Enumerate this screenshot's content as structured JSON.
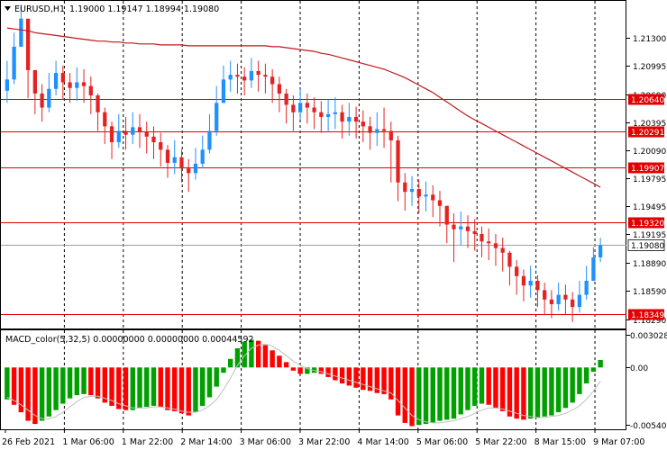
{
  "header": {
    "symbol": "EURUSD,H1",
    "ohlc": "1.19000 1.19147 1.18994 1.19080"
  },
  "chart_data": [
    {
      "type": "candlestick",
      "series": [
        {
          "name": "EURUSD,H1",
          "close": [
            1.2085,
            1.212,
            1.215,
            1.2095,
            1.207,
            1.2055,
            1.2075,
            1.2092,
            1.2082,
            1.2076,
            1.2082,
            1.2078,
            1.2068,
            1.205,
            1.2035,
            1.2018,
            1.203,
            1.2026,
            1.2034,
            1.2029,
            1.2024,
            1.2018,
            1.201,
            1.1996,
            1.2002,
            1.199,
            1.1985,
            1.1995,
            1.201,
            1.203,
            1.206,
            1.2085,
            1.209,
            1.2088,
            1.2084,
            1.2094,
            1.209,
            1.2088,
            1.208,
            1.207,
            1.2058,
            1.205,
            1.206,
            1.2055,
            1.205,
            1.2045,
            1.2048,
            1.205,
            1.204,
            1.2045,
            1.204,
            1.2035,
            1.2028,
            1.2032,
            1.203,
            1.202,
            1.1975,
            1.1965,
            1.1968,
            1.196,
            1.1962,
            1.1956,
            1.195,
            1.193,
            1.1925,
            1.1928,
            1.1923,
            1.192,
            1.1912,
            1.191,
            1.1905,
            1.19,
            1.1885,
            1.1875,
            1.1865,
            1.187,
            1.186,
            1.185,
            1.1845,
            1.1855,
            1.185,
            1.1842,
            1.1855,
            1.187,
            1.1895,
            1.1908
          ],
          "high": [
            1.2105,
            1.2135,
            1.2165,
            1.2125,
            1.209,
            1.208,
            1.2092,
            1.2105,
            1.21,
            1.2092,
            1.2098,
            1.2096,
            1.2088,
            1.207,
            1.2055,
            1.204,
            1.2048,
            1.2045,
            1.205,
            1.2048,
            1.204,
            1.2035,
            1.2028,
            1.2015,
            1.202,
            1.201,
            1.2,
            1.2012,
            1.2025,
            1.2048,
            1.2078,
            1.21,
            1.2105,
            1.2102,
            1.2098,
            1.2108,
            1.2105,
            1.2102,
            1.2096,
            1.2088,
            1.2075,
            1.2068,
            1.2075,
            1.207,
            1.2066,
            1.2062,
            1.2064,
            1.2066,
            1.2058,
            1.206,
            1.2056,
            1.2052,
            1.2045,
            1.205,
            1.2055,
            1.204,
            1.2025,
            1.1985,
            1.1982,
            1.1978,
            1.1976,
            1.1972,
            1.1966,
            1.195,
            1.1942,
            1.1944,
            1.194,
            1.1936,
            1.1928,
            1.1926,
            1.192,
            1.1916,
            1.1902,
            1.1892,
            1.1882,
            1.1886,
            1.1876,
            1.1868,
            1.186,
            1.1868,
            1.1866,
            1.1858,
            1.187,
            1.1886,
            1.1906,
            1.1916
          ],
          "low": [
            1.206,
            1.208,
            1.212,
            1.2065,
            1.2048,
            1.204,
            1.205,
            1.2068,
            1.2064,
            1.206,
            1.2062,
            1.206,
            1.2048,
            1.203,
            1.2016,
            1.2,
            1.2012,
            1.201,
            1.2016,
            1.2012,
            1.2006,
            1.2,
            1.1992,
            1.198,
            1.1984,
            1.1975,
            1.1965,
            1.1978,
            1.199,
            1.2006,
            1.2025,
            1.206,
            1.2072,
            1.207,
            1.2068,
            1.2076,
            1.2072,
            1.207,
            1.206,
            1.205,
            1.2038,
            1.203,
            1.2042,
            1.2038,
            1.2032,
            1.2028,
            1.203,
            1.2032,
            1.2022,
            1.2025,
            1.2022,
            1.2018,
            1.201,
            1.2014,
            1.2012,
            1.1975,
            1.1955,
            1.1945,
            1.195,
            1.1942,
            1.1944,
            1.1938,
            1.1928,
            1.191,
            1.189,
            1.1908,
            1.1905,
            1.1902,
            1.1895,
            1.1892,
            1.1886,
            1.188,
            1.1865,
            1.1855,
            1.1848,
            1.1852,
            1.1842,
            1.1834,
            1.183,
            1.1838,
            1.1834,
            1.1826,
            1.1836,
            1.185,
            1.1872,
            1.189
          ]
        },
        {
          "name": "moving average",
          "values": [
            1.214,
            1.2139,
            1.2138,
            1.2137,
            1.2135,
            1.2134,
            1.2133,
            1.2132,
            1.2131,
            1.213,
            1.2129,
            1.2128,
            1.2127,
            1.2126,
            1.2126,
            1.2125,
            1.2125,
            1.2124,
            1.2124,
            1.2123,
            1.2123,
            1.2123,
            1.2122,
            1.2122,
            1.2122,
            1.2122,
            1.2121,
            1.2121,
            1.2121,
            1.2121,
            1.2121,
            1.2121,
            1.2121,
            1.2121,
            1.2121,
            1.2121,
            1.2121,
            1.2121,
            1.212,
            1.212,
            1.2119,
            1.2118,
            1.2117,
            1.2116,
            1.2115,
            1.2113,
            1.2112,
            1.211,
            1.2108,
            1.2106,
            1.2104,
            1.2102,
            1.21,
            1.2098,
            1.2096,
            1.2093,
            1.209,
            1.2087,
            1.2083,
            1.2079,
            1.2075,
            1.2071,
            1.2066,
            1.2061,
            1.2056,
            1.2051,
            1.2046,
            1.2042,
            1.2038,
            1.2034,
            1.203,
            1.2026,
            1.2022,
            1.2018,
            1.2014,
            1.201,
            1.2006,
            1.2002,
            1.1998,
            1.1994,
            1.199,
            1.1986,
            1.1982,
            1.1978,
            1.1974,
            1.197
          ]
        }
      ],
      "hlines": [
        {
          "value": 1.2064,
          "label": "1.20640"
        },
        {
          "value": 1.20291,
          "label": "1.20291"
        },
        {
          "value": 1.19907,
          "label": "1.19907"
        },
        {
          "value": 1.1932,
          "label": "1.19320"
        },
        {
          "value": 1.1908,
          "label": "1.19080",
          "current": true
        },
        {
          "value": 1.18349,
          "label": "1.18349"
        }
      ],
      "yticks": [
        "1.21300",
        "1.20995",
        "1.20690",
        "1.20395",
        "1.20090",
        "1.19795",
        "1.19495",
        "1.19195",
        "1.18890",
        "1.18590",
        "1.18290"
      ],
      "ylim": [
        1.182,
        1.2168
      ],
      "xticks": [
        "26 Feb 2021",
        "1 Mar 06:00",
        "1 Mar 22:00",
        "2 Mar 14:00",
        "3 Mar 06:00",
        "3 Mar 22:00",
        "4 Mar 14:00",
        "5 Mar 06:00",
        "5 Mar 22:00",
        "8 Mar 15:00",
        "9 Mar 07:00"
      ],
      "colors": {
        "bull": "#1e90ff",
        "bear": "#e52222",
        "ma": "#c0161a",
        "hline": "#e00000",
        "current": "#a0a0a0"
      }
    },
    {
      "type": "bar",
      "title": "MACD_color(5,32,5) 0.00000000 0.00000000 0.00044592",
      "series": [
        {
          "name": "histogram",
          "values": [
            -0.003,
            -0.0035,
            -0.0042,
            -0.005,
            -0.0053,
            -0.005,
            -0.0046,
            -0.004,
            -0.0034,
            -0.0029,
            -0.0026,
            -0.0025,
            -0.0026,
            -0.0029,
            -0.0033,
            -0.0036,
            -0.0039,
            -0.004,
            -0.004,
            -0.0038,
            -0.0037,
            -0.0036,
            -0.0037,
            -0.004,
            -0.0041,
            -0.0043,
            -0.0045,
            -0.0042,
            -0.0036,
            -0.0028,
            -0.0018,
            -0.0005,
            0.0008,
            0.0018,
            0.0024,
            0.0026,
            0.0025,
            0.0021,
            0.0016,
            0.0011,
            0.0005,
            -0.0003,
            -0.0006,
            -0.0006,
            -0.0005,
            -0.0006,
            -0.0009,
            -0.0012,
            -0.0015,
            -0.0017,
            -0.0019,
            -0.0021,
            -0.0022,
            -0.0024,
            -0.0025,
            -0.003,
            -0.0045,
            -0.0052,
            -0.0055,
            -0.0054,
            -0.0053,
            -0.0052,
            -0.005,
            -0.0049,
            -0.0048,
            -0.0044,
            -0.004,
            -0.0036,
            -0.0034,
            -0.0035,
            -0.0038,
            -0.0041,
            -0.0046,
            -0.0048,
            -0.0049,
            -0.0048,
            -0.0047,
            -0.0046,
            -0.0045,
            -0.0042,
            -0.0038,
            -0.0033,
            -0.0025,
            -0.0015,
            -0.0004,
            0.0007
          ]
        },
        {
          "name": "signal",
          "values": [
            -0.0028,
            -0.0031,
            -0.0035,
            -0.004,
            -0.0045,
            -0.0048,
            -0.0048,
            -0.0046,
            -0.0042,
            -0.0037,
            -0.0032,
            -0.0028,
            -0.0027,
            -0.0027,
            -0.0029,
            -0.0031,
            -0.0034,
            -0.0036,
            -0.0038,
            -0.0038,
            -0.0038,
            -0.0037,
            -0.0037,
            -0.0038,
            -0.0039,
            -0.0041,
            -0.0042,
            -0.0042,
            -0.004,
            -0.0036,
            -0.003,
            -0.0021,
            -0.001,
            0.0002,
            0.0011,
            0.0018,
            0.0021,
            0.0022,
            0.002,
            0.0016,
            0.0011,
            0.0006,
            0.0002,
            -0.0001,
            -0.0003,
            -0.0004,
            -0.0006,
            -0.0008,
            -0.001,
            -0.0012,
            -0.0014,
            -0.0016,
            -0.0018,
            -0.002,
            -0.0022,
            -0.0024,
            -0.0031,
            -0.0038,
            -0.0045,
            -0.0049,
            -0.0051,
            -0.0052,
            -0.0052,
            -0.0051,
            -0.005,
            -0.0048,
            -0.0046,
            -0.0043,
            -0.004,
            -0.0038,
            -0.0038,
            -0.0039,
            -0.0041,
            -0.0043,
            -0.0045,
            -0.0046,
            -0.0047,
            -0.0047,
            -0.0046,
            -0.0045,
            -0.0043,
            -0.004,
            -0.0036,
            -0.003,
            -0.0022,
            -0.0013
          ]
        }
      ],
      "yticks": [
        "0.0030284",
        "0.00",
        "-0.005403"
      ],
      "ylim": [
        -0.0058,
        0.0034
      ],
      "colors": {
        "up": "#00a000",
        "down": "#ff0000",
        "signal": "#c0c0c0"
      }
    }
  ]
}
